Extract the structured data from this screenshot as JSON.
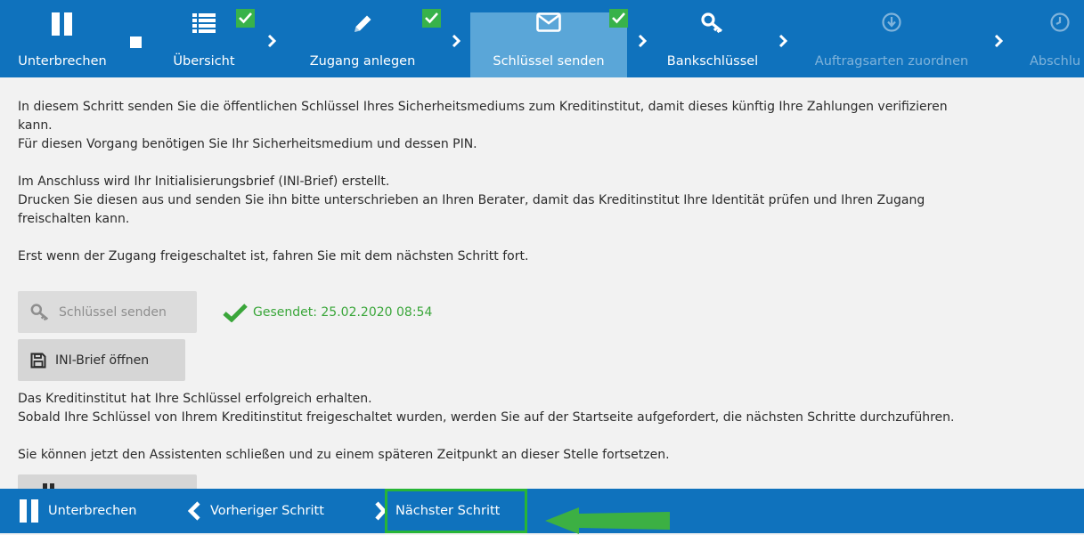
{
  "wizard": {
    "pause_label": "Unterbrechen",
    "steps": [
      {
        "label": "Übersicht",
        "icon": "list-icon",
        "completed": true,
        "state": "done"
      },
      {
        "label": "Zugang anlegen",
        "icon": "pencil-icon",
        "completed": true,
        "state": "done"
      },
      {
        "label": "Schlüssel senden",
        "icon": "envelope-icon",
        "completed": true,
        "state": "active"
      },
      {
        "label": "Bankschlüssel",
        "icon": "key-icon",
        "completed": false,
        "state": "normal"
      },
      {
        "label": "Auftragsarten zuordnen",
        "icon": "download-circle-icon",
        "completed": false,
        "state": "disabled"
      },
      {
        "label": "Abschlu",
        "icon": "clock-icon",
        "completed": false,
        "state": "disabled"
      }
    ]
  },
  "content": {
    "intro_1": "In diesem Schritt senden Sie die öffentlichen Schlüssel Ihres Sicherheitsmediums zum Kreditinstitut, damit dieses künftig Ihre Zahlungen verifizieren",
    "intro_1b": "kann.",
    "intro_2": "Für diesen Vorgang benötigen Sie Ihr Sicherheitsmedium und dessen PIN.",
    "ini_1": "Im Anschluss wird Ihr Initialisierungsbrief (INI-Brief) erstellt.",
    "ini_2": "Drucken Sie diesen aus und senden Sie ihn bitte unterschrieben an Ihren Berater, damit das Kreditinstitut Ihre Identität prüfen und Ihren Zugang",
    "ini_2b": "freischalten kann.",
    "next_note": "Erst wenn der Zugang freigeschaltet ist, fahren Sie mit dem nächsten Schritt fort.",
    "send_keys_button": "Schlüssel senden",
    "sent_status": "Gesendet: 25.02.2020 08:54",
    "open_ini_button": "INI-Brief öffnen",
    "received_1": "Das Kreditinstitut hat Ihre Schlüssel erfolgreich erhalten.",
    "received_2": "Sobald Ihre Schlüssel von Ihrem Kreditinstitut freigeschaltet wurden, werden Sie auf der Startseite aufgefordert, die nächsten Schritte durchzuführen.",
    "close_note": "Sie können jetzt den Assistenten schließen und zu einem späteren Zeitpunkt an dieser Stelle fortsetzen."
  },
  "bottom": {
    "pause_label": "Unterbrechen",
    "prev_label": "Vorheriger Schritt",
    "next_label": "Nächster Schritt"
  },
  "colors": {
    "bar_blue": "#0f72bd",
    "active_step": "#5aa6d8",
    "success_green": "#38b24a",
    "highlight_green": "#27b537"
  }
}
